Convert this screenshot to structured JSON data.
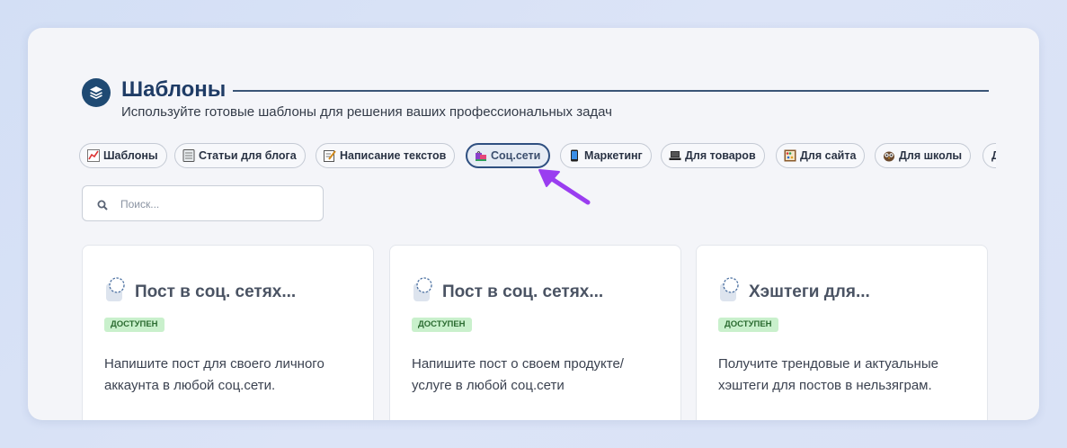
{
  "header": {
    "title": "Шаблоны",
    "subtitle": "Используйте готовые шаблоны для решения ваших профессиональных задач"
  },
  "categories": [
    {
      "label": "Шаблоны",
      "icon": "chart-icon",
      "active": false
    },
    {
      "label": "Статьи для блога",
      "icon": "notebook-icon",
      "active": false
    },
    {
      "label": "Написание текстов",
      "icon": "memo-icon",
      "active": false
    },
    {
      "label": "Соц.сети",
      "icon": "shopping-bags-icon",
      "active": true
    },
    {
      "label": "Маркетинг",
      "icon": "phone-icon",
      "active": false
    },
    {
      "label": "Для товаров",
      "icon": "laptop-icon",
      "active": false
    },
    {
      "label": "Для сайта",
      "icon": "abacus-icon",
      "active": false
    },
    {
      "label": "Для школы",
      "icon": "owl-icon",
      "active": false
    },
    {
      "label": "Д",
      "icon": "",
      "active": false
    }
  ],
  "search": {
    "placeholder": "Поиск..."
  },
  "cards": [
    {
      "title": "Пост в соц. сетях...",
      "badge": "ДОСТУПЕН",
      "description": "Напишите пост для своего личного аккаунта в любой соц.сети."
    },
    {
      "title": "Пост в соц. сетях...",
      "badge": "ДОСТУПЕН",
      "description": "Напишите пост о своем продукте/ услуге в любой соц.сети"
    },
    {
      "title": "Хэштеги для...",
      "badge": "ДОСТУПЕН",
      "description": "Получите трендовые и актуальные хэштеги для постов в нельзяграм."
    }
  ],
  "colors": {
    "accent": "#1f4a73",
    "badge_bg": "#c9f0cc",
    "badge_text": "#2b6b31",
    "arrow": "#9a3df0"
  }
}
